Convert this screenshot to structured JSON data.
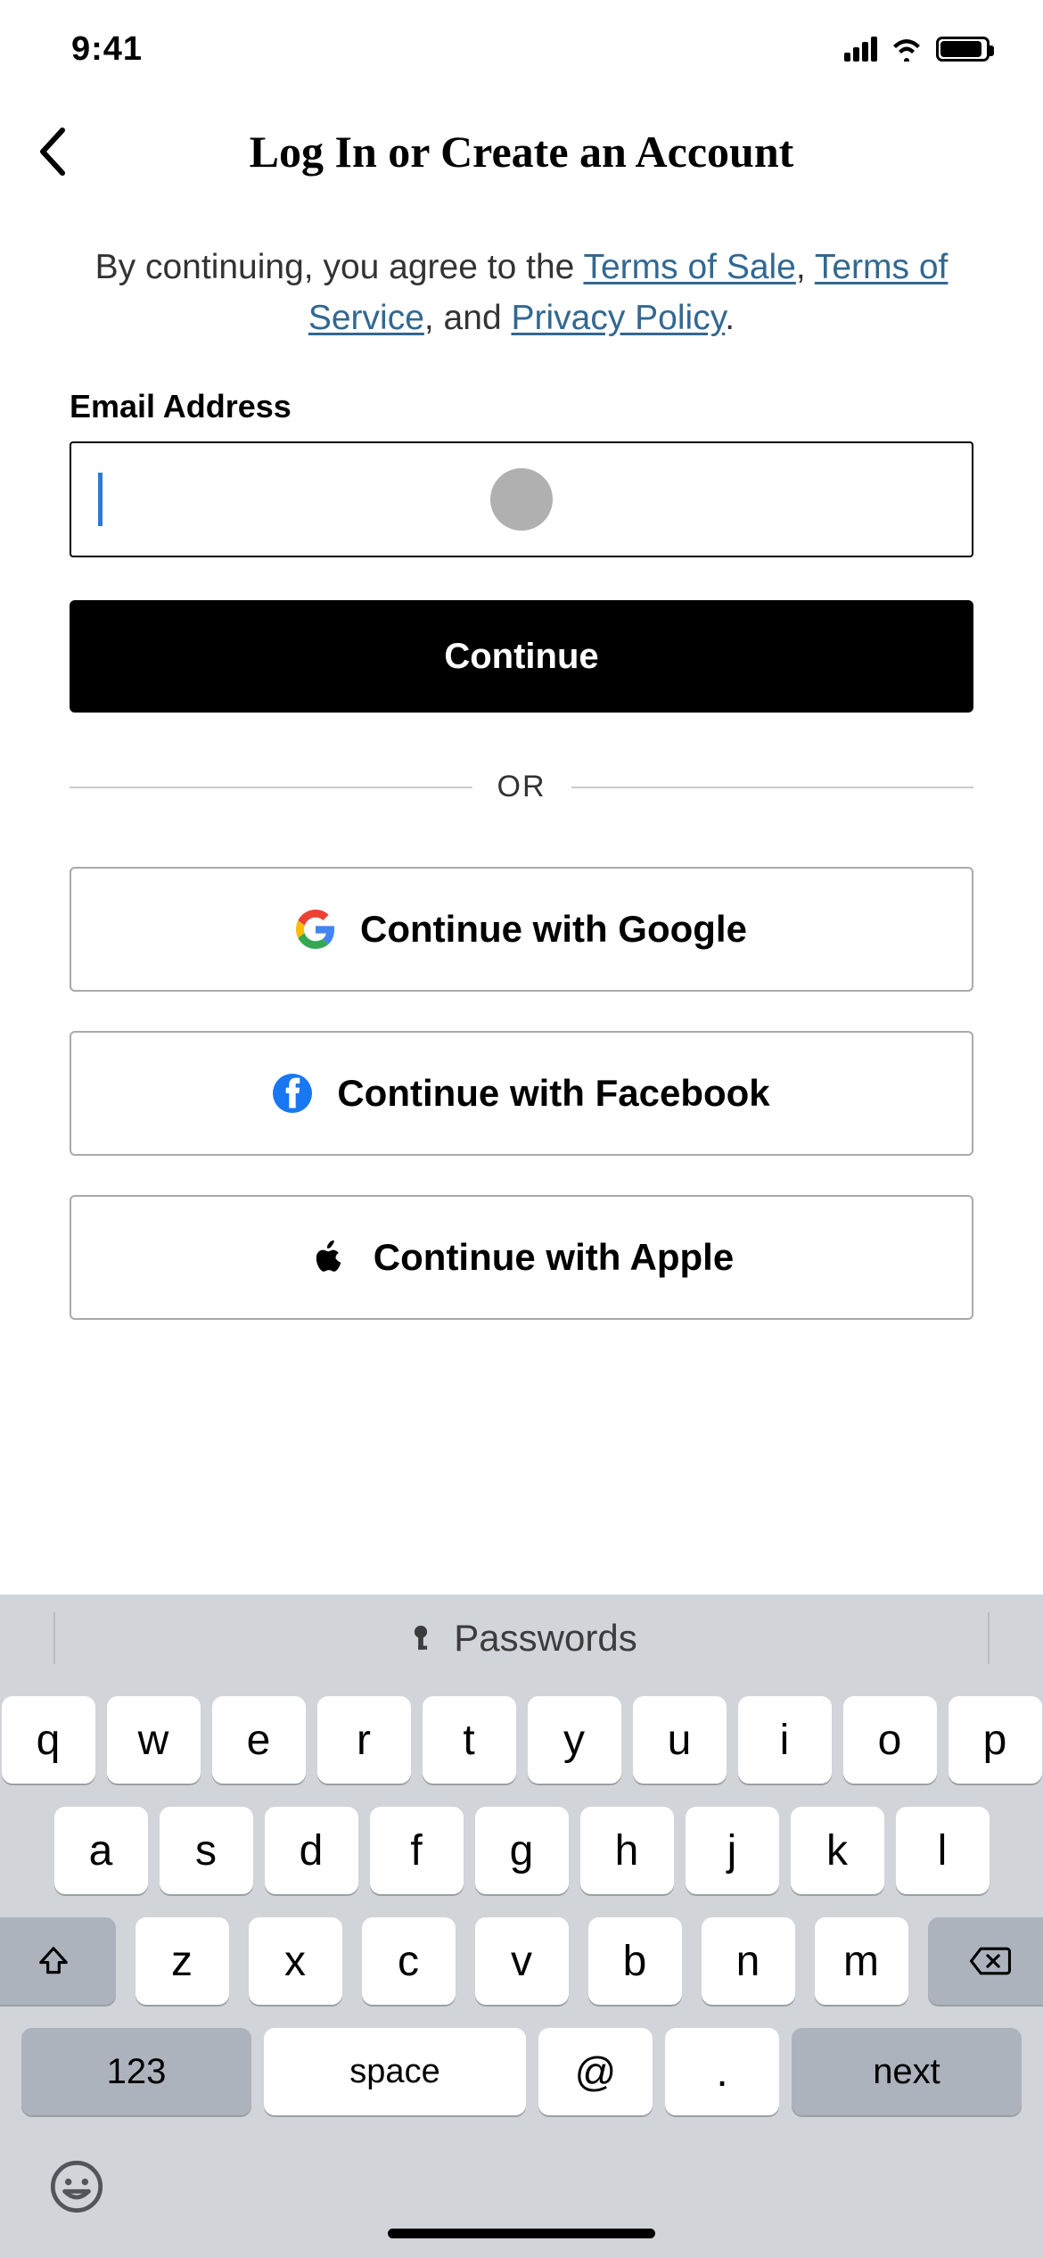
{
  "status": {
    "time": "9:41"
  },
  "header": {
    "title": "Log In or Create an Account"
  },
  "terms": {
    "prefix": "By continuing, you agree to the ",
    "terms_of_sale": "Terms of Sale",
    "sep1": ", ",
    "terms_of_service": "Terms of Service",
    "sep2": ", and ",
    "privacy_policy": "Privacy Policy",
    "suffix": "."
  },
  "form": {
    "email_label": "Email Address",
    "email_value": "",
    "continue_label": "Continue"
  },
  "divider": {
    "or": "OR"
  },
  "social": {
    "google": "Continue with Google",
    "facebook": "Continue with Facebook",
    "apple": "Continue with Apple"
  },
  "keyboard": {
    "suggestion": "Passwords",
    "row1": [
      "q",
      "w",
      "e",
      "r",
      "t",
      "y",
      "u",
      "i",
      "o",
      "p"
    ],
    "row2": [
      "a",
      "s",
      "d",
      "f",
      "g",
      "h",
      "j",
      "k",
      "l"
    ],
    "row3": [
      "z",
      "x",
      "c",
      "v",
      "b",
      "n",
      "m"
    ],
    "k123": "123",
    "space": "space",
    "at": "@",
    "dot": ".",
    "next": "next"
  }
}
